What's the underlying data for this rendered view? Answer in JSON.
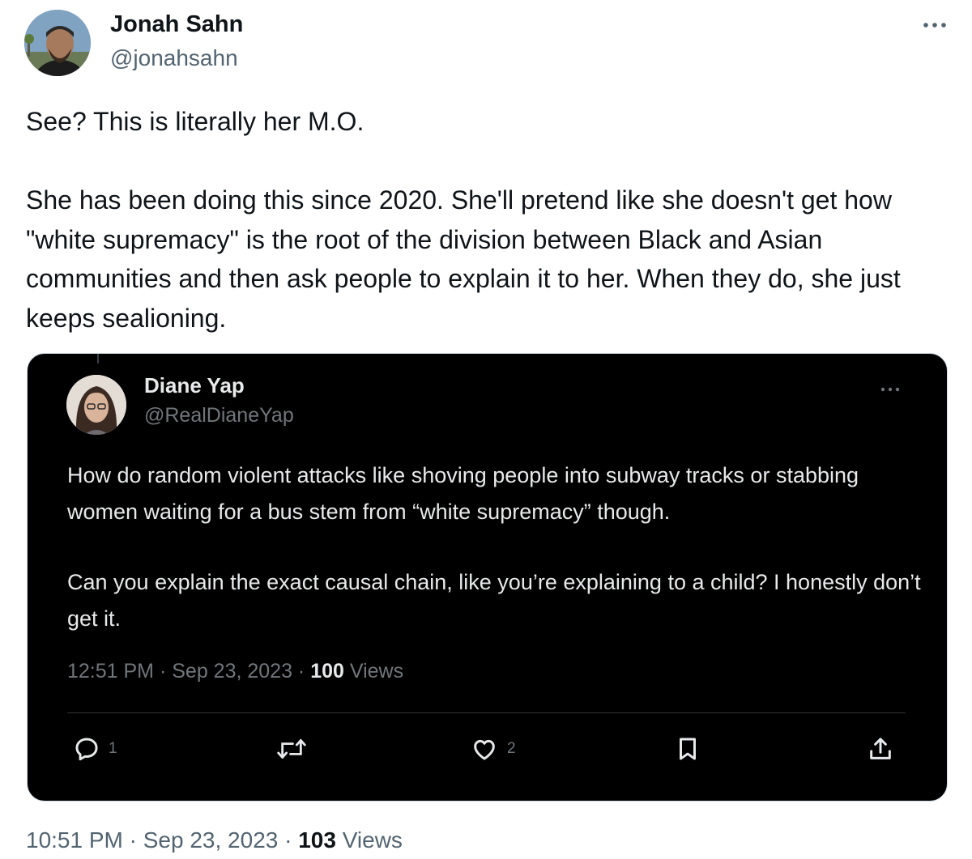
{
  "author": {
    "name": "Jonah Sahn",
    "handle": "@jonahsahn"
  },
  "tweet": {
    "paragraphs": [
      "See? This is literally her M.O.",
      "She has been doing this since 2020. She'll pretend like she doesn't get how \"white supremacy\" is the root of the division between Black and Asian communities and then ask people to explain it to her. When they do, she just keeps sealioning."
    ],
    "time": "10:51 PM",
    "date": "Sep 23, 2023",
    "views_count": "103",
    "views_label": "Views"
  },
  "quoted": {
    "name": "Diane Yap",
    "handle": "@RealDianeYap",
    "paragraphs": [
      "How do random violent attacks like shoving people into subway tracks or stabbing women waiting for a bus stem from “white supremacy” though.",
      "Can you explain the exact causal chain, like you’re explaining to a child? I honestly don’t get it."
    ],
    "time": "12:51 PM",
    "date": "Sep 23, 2023",
    "views_count": "100",
    "views_label": "Views",
    "actions": {
      "reply_count": "1",
      "like_count": "2"
    }
  },
  "icons": [
    "more-icon",
    "reply-icon",
    "retweet-icon",
    "like-icon",
    "bookmark-icon",
    "share-icon"
  ],
  "colors": {
    "text_primary": "#0f1419",
    "text_secondary": "#536471",
    "dark_card_bg": "#000000",
    "dark_text": "#e7e9ea",
    "dark_secondary": "#71767b"
  }
}
